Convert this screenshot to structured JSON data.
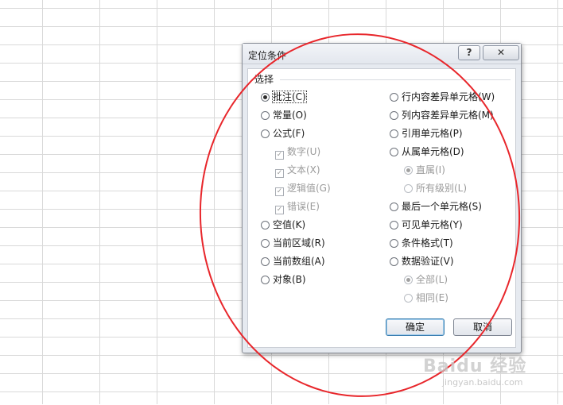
{
  "dialog": {
    "title": "定位条件",
    "help_label": "?",
    "close_label": "✕",
    "group_label": "选择",
    "left_options": [
      {
        "label": "批注(C)",
        "control": "radio",
        "checked": true,
        "disabled": false
      },
      {
        "label": "常量(O)",
        "control": "radio",
        "checked": false,
        "disabled": false
      },
      {
        "label": "公式(F)",
        "control": "radio",
        "checked": false,
        "disabled": false
      },
      {
        "label": "数字(U)",
        "control": "check",
        "checked": true,
        "disabled": true
      },
      {
        "label": "文本(X)",
        "control": "check",
        "checked": true,
        "disabled": true
      },
      {
        "label": "逻辑值(G)",
        "control": "check",
        "checked": true,
        "disabled": true
      },
      {
        "label": "错误(E)",
        "control": "check",
        "checked": true,
        "disabled": true
      },
      {
        "label": "空值(K)",
        "control": "radio",
        "checked": false,
        "disabled": false
      },
      {
        "label": "当前区域(R)",
        "control": "radio",
        "checked": false,
        "disabled": false
      },
      {
        "label": "当前数组(A)",
        "control": "radio",
        "checked": false,
        "disabled": false
      },
      {
        "label": "对象(B)",
        "control": "radio",
        "checked": false,
        "disabled": false
      }
    ],
    "right_options": [
      {
        "label": "行内容差异单元格(W)",
        "control": "radio",
        "checked": false,
        "disabled": false
      },
      {
        "label": "列内容差异单元格(M)",
        "control": "radio",
        "checked": false,
        "disabled": false
      },
      {
        "label": "引用单元格(P)",
        "control": "radio",
        "checked": false,
        "disabled": false
      },
      {
        "label": "从属单元格(D)",
        "control": "radio",
        "checked": false,
        "disabled": false
      },
      {
        "label": "直属(I)",
        "control": "radio",
        "checked": true,
        "disabled": true
      },
      {
        "label": "所有级别(L)",
        "control": "radio",
        "checked": false,
        "disabled": true
      },
      {
        "label": "最后一个单元格(S)",
        "control": "radio",
        "checked": false,
        "disabled": false
      },
      {
        "label": "可见单元格(Y)",
        "control": "radio",
        "checked": false,
        "disabled": false
      },
      {
        "label": "条件格式(T)",
        "control": "radio",
        "checked": false,
        "disabled": false
      },
      {
        "label": "数据验证(V)",
        "control": "radio",
        "checked": false,
        "disabled": false
      },
      {
        "label": "全部(L)",
        "control": "radio",
        "checked": true,
        "disabled": true
      },
      {
        "label": "相同(E)",
        "control": "radio",
        "checked": false,
        "disabled": true
      }
    ],
    "ok_label": "确定",
    "cancel_label": "取消"
  },
  "watermark": {
    "brand": "Baidu 经验",
    "url": "jingyan.baidu.com"
  },
  "colors": {
    "annotation": "#e8262b",
    "default_button_border": "#3c7fb1"
  }
}
